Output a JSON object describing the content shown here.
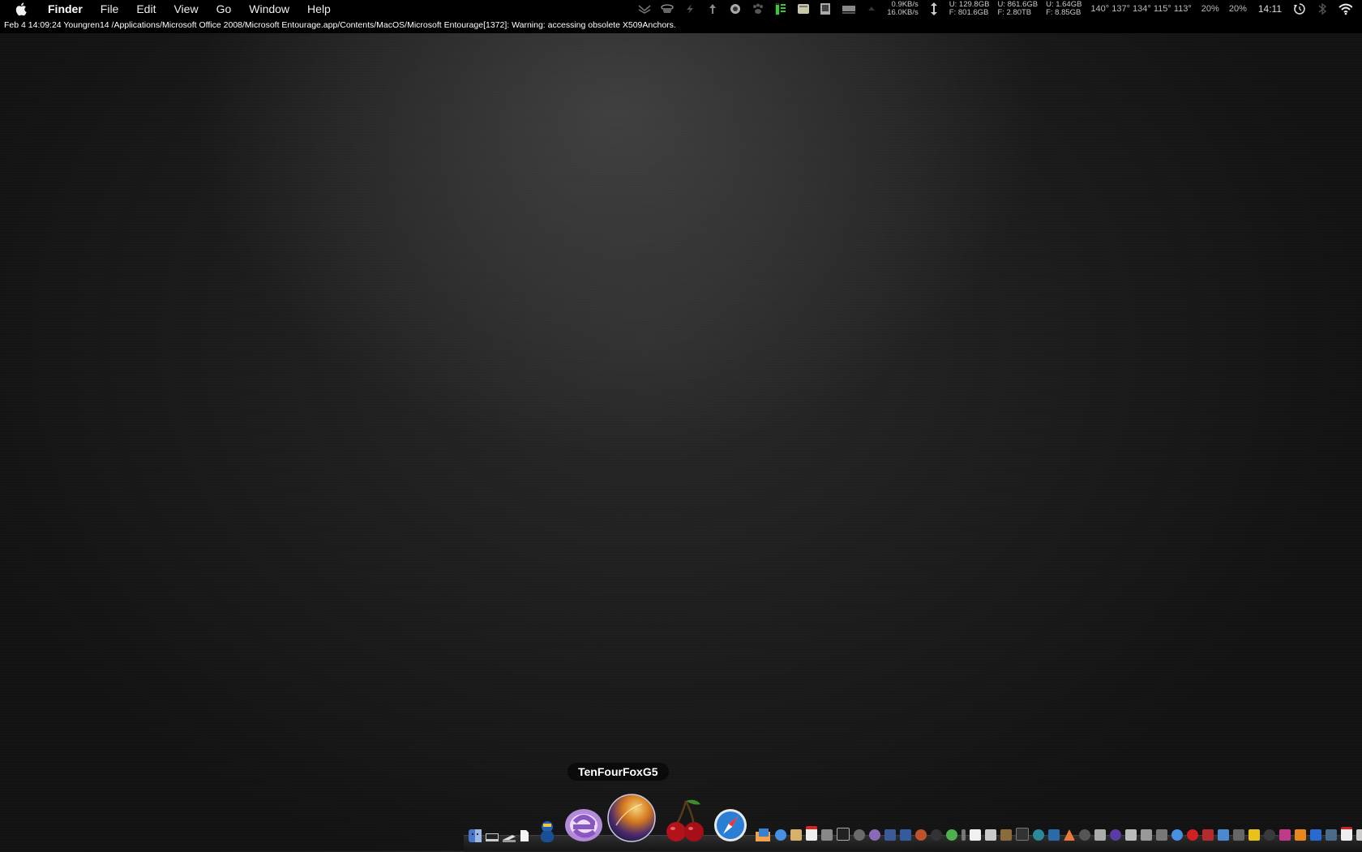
{
  "menubar": {
    "apple_icon": "apple-logo-icon",
    "app_name": "Finder",
    "items": [
      "File",
      "Edit",
      "View",
      "Go",
      "Window",
      "Help"
    ]
  },
  "status": {
    "net_up": "0.9KB/s",
    "net_down": "16.0KB/s",
    "disk1_used": "U: 129.8GB",
    "disk1_free": "F: 801.6GB",
    "disk2_used": "U: 861.6GB",
    "disk2_free": "F: 2.80TB",
    "disk3_used": "U: 1.64GB",
    "disk3_free": "F: 8.85GB",
    "temps": "140° 137° 134° 115° 113°",
    "cpu1": "20%",
    "cpu2": "20%",
    "clock": "14:11"
  },
  "console": {
    "line": "Feb  4 14:09:24 Youngren14 /Applications/Microsoft Office 2008/Microsoft Entourage.app/Contents/MacOS/Microsoft Entourage[1372]: Warning: accessing obsolete X509Anchors."
  },
  "dock": {
    "hover_label": "TenFourFoxG5",
    "colors": {
      "entourage": "#b28ad8",
      "tenfourfox": "#e08a2a",
      "cherry": "#b3121a",
      "safari": "#2a7fd4"
    }
  }
}
